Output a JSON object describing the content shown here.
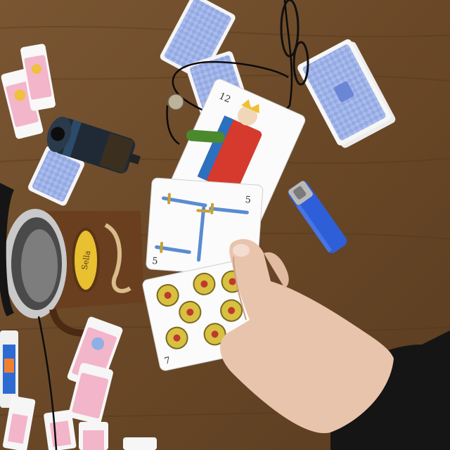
{
  "scene": {
    "subject": "hand holding Spanish playing cards on a wooden table",
    "cards_in_hand": [
      {
        "rank_label": "12",
        "suit": "copas-king-card"
      },
      {
        "rank_label": "5",
        "suit": "espadas"
      },
      {
        "rank_label": "7",
        "suit": "oros"
      }
    ],
    "mug_label": "Sella",
    "colors": {
      "table": "#6b4a2b",
      "card_back": "#8fa6e0",
      "lighter": "#2f5fd8",
      "sleeve": "#151515",
      "skin": "#e9c4ad",
      "coin": "#d8c040"
    }
  }
}
